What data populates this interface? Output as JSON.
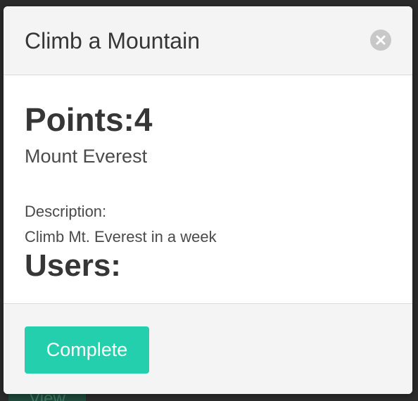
{
  "background": {
    "view_button_label": "View"
  },
  "modal": {
    "title": "Climb a Mountain",
    "close_icon": "close-icon",
    "points_label": "Points:",
    "points_value": "4",
    "points_text": "Points:4",
    "subtitle": "Mount Everest",
    "description_label": "Description:",
    "description_text": "Climb Mt. Everest in a week",
    "users_label": "Users:",
    "complete_button_label": "Complete"
  },
  "colors": {
    "accent": "#23cfad",
    "header_bg": "#f4f4f4",
    "overlay": "#2b2b2b",
    "text_dark": "#363636"
  }
}
